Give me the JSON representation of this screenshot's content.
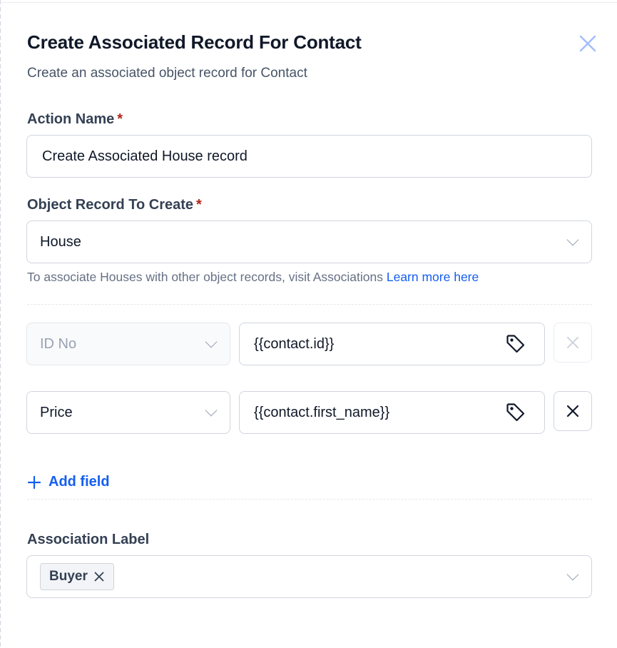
{
  "header": {
    "title": "Create Associated Record For Contact",
    "subtitle": "Create an associated object record for Contact",
    "close_icon": "close-icon"
  },
  "action_name": {
    "label": "Action Name",
    "required_mark": "*",
    "value": "Create Associated House record"
  },
  "object_record": {
    "label": "Object Record To Create",
    "required_mark": "*",
    "value": "House",
    "hint_text": "To associate Houses with other object records, visit Associations",
    "hint_link": "Learn more here"
  },
  "field_mappings": [
    {
      "field": "ID No",
      "value": "{{contact.id}}",
      "disabled": true
    },
    {
      "field": "Price",
      "value": "{{contact.first_name}}",
      "disabled": false
    }
  ],
  "add_field_label": "Add field",
  "association": {
    "label": "Association Label",
    "chips": [
      "Buyer"
    ]
  },
  "colors": {
    "accent": "#155eef",
    "required": "#b42318",
    "border": "#d0d5dd"
  }
}
